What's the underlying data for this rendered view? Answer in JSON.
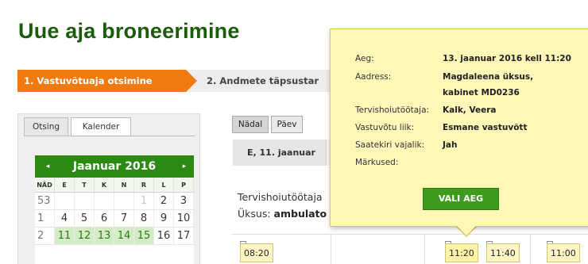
{
  "page": {
    "title": "Uue aja broneerimine"
  },
  "steps": {
    "active": "1. Vastuvõtuaja otsimine",
    "next": "2. Andmete täpsustar"
  },
  "side_tabs": {
    "search": "Otsing",
    "calendar": "Kalender"
  },
  "calendar": {
    "prev": "◂",
    "next": "▸",
    "month": "Jaanuar 2016",
    "weekday_headers": [
      "NÄD",
      "E",
      "T",
      "K",
      "N",
      "R",
      "L",
      "P"
    ],
    "rows": [
      [
        "53",
        "",
        "",
        "",
        "",
        "1",
        "2",
        "3"
      ],
      [
        "1",
        "4",
        "5",
        "6",
        "7",
        "8",
        "9",
        "10"
      ],
      [
        "2",
        "11",
        "12",
        "13",
        "14",
        "15",
        "16",
        "17"
      ]
    ],
    "colors": {
      "header": "#2a8a14",
      "selected": "#d4ecc6"
    }
  },
  "view": {
    "week": "Nädal",
    "day": "Päev",
    "day_header": "E, 11. jaanuar"
  },
  "schedule": {
    "employee_label": "Tervishoiutöötaja",
    "unit_label": "Üksus:",
    "unit_value": "ambulato",
    "slots": [
      "08:20",
      "11:20",
      "11:40",
      "11:00"
    ]
  },
  "popup": {
    "close": "×",
    "fields": [
      {
        "label": "Aeg:",
        "value": "13. jaanuar 2016 kell 11:20"
      },
      {
        "label": "Aadress:",
        "value": "Magdaleena üksus,"
      },
      {
        "label": "",
        "value": "kabinet MD0236"
      },
      {
        "label": "Tervishoiutöötaja:",
        "value": "Kalk, Veera"
      },
      {
        "label": "Vastuvõtu liik:",
        "value": "Esmane vastuvõtt"
      },
      {
        "label": "Saatekiri vajalik:",
        "value": "Jah"
      },
      {
        "label": "Märkused:",
        "value": ""
      }
    ],
    "button": "VALI AEG",
    "colors": {
      "background": "#fff7b8",
      "button": "#3d9c1e",
      "accent": "#f07a0f"
    }
  }
}
